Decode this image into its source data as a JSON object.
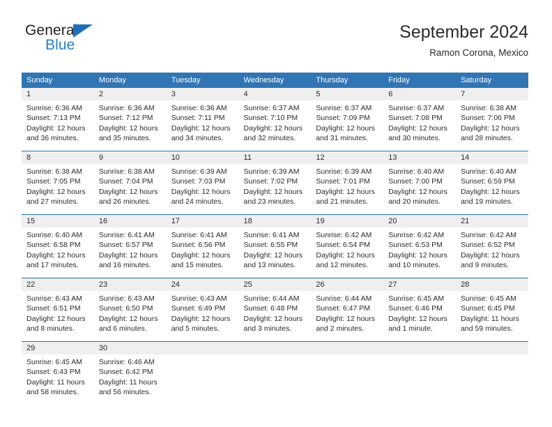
{
  "logo": {
    "word_top": "General",
    "word_bottom": "Blue",
    "triangle_color": "#1f6fb8",
    "blue_color": "#2480c6"
  },
  "header": {
    "title": "September 2024",
    "subtitle": "Ramon Corona, Mexico"
  },
  "theme": {
    "header_blue": "#3175b4",
    "row_divider": "#2f6fa8",
    "daynum_band": "#efefef",
    "text": "#2b2b2b"
  },
  "weekday_headers": [
    "Sunday",
    "Monday",
    "Tuesday",
    "Wednesday",
    "Thursday",
    "Friday",
    "Saturday"
  ],
  "weeks": [
    [
      {
        "day": "1",
        "sunrise": "Sunrise: 6:36 AM",
        "sunset": "Sunset: 7:13 PM",
        "daylight1": "Daylight: 12 hours",
        "daylight2": "and 36 minutes."
      },
      {
        "day": "2",
        "sunrise": "Sunrise: 6:36 AM",
        "sunset": "Sunset: 7:12 PM",
        "daylight1": "Daylight: 12 hours",
        "daylight2": "and 35 minutes."
      },
      {
        "day": "3",
        "sunrise": "Sunrise: 6:36 AM",
        "sunset": "Sunset: 7:11 PM",
        "daylight1": "Daylight: 12 hours",
        "daylight2": "and 34 minutes."
      },
      {
        "day": "4",
        "sunrise": "Sunrise: 6:37 AM",
        "sunset": "Sunset: 7:10 PM",
        "daylight1": "Daylight: 12 hours",
        "daylight2": "and 32 minutes."
      },
      {
        "day": "5",
        "sunrise": "Sunrise: 6:37 AM",
        "sunset": "Sunset: 7:09 PM",
        "daylight1": "Daylight: 12 hours",
        "daylight2": "and 31 minutes."
      },
      {
        "day": "6",
        "sunrise": "Sunrise: 6:37 AM",
        "sunset": "Sunset: 7:08 PM",
        "daylight1": "Daylight: 12 hours",
        "daylight2": "and 30 minutes."
      },
      {
        "day": "7",
        "sunrise": "Sunrise: 6:38 AM",
        "sunset": "Sunset: 7:06 PM",
        "daylight1": "Daylight: 12 hours",
        "daylight2": "and 28 minutes."
      }
    ],
    [
      {
        "day": "8",
        "sunrise": "Sunrise: 6:38 AM",
        "sunset": "Sunset: 7:05 PM",
        "daylight1": "Daylight: 12 hours",
        "daylight2": "and 27 minutes."
      },
      {
        "day": "9",
        "sunrise": "Sunrise: 6:38 AM",
        "sunset": "Sunset: 7:04 PM",
        "daylight1": "Daylight: 12 hours",
        "daylight2": "and 26 minutes."
      },
      {
        "day": "10",
        "sunrise": "Sunrise: 6:39 AM",
        "sunset": "Sunset: 7:03 PM",
        "daylight1": "Daylight: 12 hours",
        "daylight2": "and 24 minutes."
      },
      {
        "day": "11",
        "sunrise": "Sunrise: 6:39 AM",
        "sunset": "Sunset: 7:02 PM",
        "daylight1": "Daylight: 12 hours",
        "daylight2": "and 23 minutes."
      },
      {
        "day": "12",
        "sunrise": "Sunrise: 6:39 AM",
        "sunset": "Sunset: 7:01 PM",
        "daylight1": "Daylight: 12 hours",
        "daylight2": "and 21 minutes."
      },
      {
        "day": "13",
        "sunrise": "Sunrise: 6:40 AM",
        "sunset": "Sunset: 7:00 PM",
        "daylight1": "Daylight: 12 hours",
        "daylight2": "and 20 minutes."
      },
      {
        "day": "14",
        "sunrise": "Sunrise: 6:40 AM",
        "sunset": "Sunset: 6:59 PM",
        "daylight1": "Daylight: 12 hours",
        "daylight2": "and 19 minutes."
      }
    ],
    [
      {
        "day": "15",
        "sunrise": "Sunrise: 6:40 AM",
        "sunset": "Sunset: 6:58 PM",
        "daylight1": "Daylight: 12 hours",
        "daylight2": "and 17 minutes."
      },
      {
        "day": "16",
        "sunrise": "Sunrise: 6:41 AM",
        "sunset": "Sunset: 6:57 PM",
        "daylight1": "Daylight: 12 hours",
        "daylight2": "and 16 minutes."
      },
      {
        "day": "17",
        "sunrise": "Sunrise: 6:41 AM",
        "sunset": "Sunset: 6:56 PM",
        "daylight1": "Daylight: 12 hours",
        "daylight2": "and 15 minutes."
      },
      {
        "day": "18",
        "sunrise": "Sunrise: 6:41 AM",
        "sunset": "Sunset: 6:55 PM",
        "daylight1": "Daylight: 12 hours",
        "daylight2": "and 13 minutes."
      },
      {
        "day": "19",
        "sunrise": "Sunrise: 6:42 AM",
        "sunset": "Sunset: 6:54 PM",
        "daylight1": "Daylight: 12 hours",
        "daylight2": "and 12 minutes."
      },
      {
        "day": "20",
        "sunrise": "Sunrise: 6:42 AM",
        "sunset": "Sunset: 6:53 PM",
        "daylight1": "Daylight: 12 hours",
        "daylight2": "and 10 minutes."
      },
      {
        "day": "21",
        "sunrise": "Sunrise: 6:42 AM",
        "sunset": "Sunset: 6:52 PM",
        "daylight1": "Daylight: 12 hours",
        "daylight2": "and 9 minutes."
      }
    ],
    [
      {
        "day": "22",
        "sunrise": "Sunrise: 6:43 AM",
        "sunset": "Sunset: 6:51 PM",
        "daylight1": "Daylight: 12 hours",
        "daylight2": "and 8 minutes."
      },
      {
        "day": "23",
        "sunrise": "Sunrise: 6:43 AM",
        "sunset": "Sunset: 6:50 PM",
        "daylight1": "Daylight: 12 hours",
        "daylight2": "and 6 minutes."
      },
      {
        "day": "24",
        "sunrise": "Sunrise: 6:43 AM",
        "sunset": "Sunset: 6:49 PM",
        "daylight1": "Daylight: 12 hours",
        "daylight2": "and 5 minutes."
      },
      {
        "day": "25",
        "sunrise": "Sunrise: 6:44 AM",
        "sunset": "Sunset: 6:48 PM",
        "daylight1": "Daylight: 12 hours",
        "daylight2": "and 3 minutes."
      },
      {
        "day": "26",
        "sunrise": "Sunrise: 6:44 AM",
        "sunset": "Sunset: 6:47 PM",
        "daylight1": "Daylight: 12 hours",
        "daylight2": "and 2 minutes."
      },
      {
        "day": "27",
        "sunrise": "Sunrise: 6:45 AM",
        "sunset": "Sunset: 6:46 PM",
        "daylight1": "Daylight: 12 hours",
        "daylight2": "and 1 minute."
      },
      {
        "day": "28",
        "sunrise": "Sunrise: 6:45 AM",
        "sunset": "Sunset: 6:45 PM",
        "daylight1": "Daylight: 11 hours",
        "daylight2": "and 59 minutes."
      }
    ],
    [
      {
        "day": "29",
        "sunrise": "Sunrise: 6:45 AM",
        "sunset": "Sunset: 6:43 PM",
        "daylight1": "Daylight: 11 hours",
        "daylight2": "and 58 minutes."
      },
      {
        "day": "30",
        "sunrise": "Sunrise: 6:46 AM",
        "sunset": "Sunset: 6:42 PM",
        "daylight1": "Daylight: 11 hours",
        "daylight2": "and 56 minutes."
      },
      {
        "day": "",
        "sunrise": "",
        "sunset": "",
        "daylight1": "",
        "daylight2": ""
      },
      {
        "day": "",
        "sunrise": "",
        "sunset": "",
        "daylight1": "",
        "daylight2": ""
      },
      {
        "day": "",
        "sunrise": "",
        "sunset": "",
        "daylight1": "",
        "daylight2": ""
      },
      {
        "day": "",
        "sunrise": "",
        "sunset": "",
        "daylight1": "",
        "daylight2": ""
      },
      {
        "day": "",
        "sunrise": "",
        "sunset": "",
        "daylight1": "",
        "daylight2": ""
      }
    ]
  ]
}
